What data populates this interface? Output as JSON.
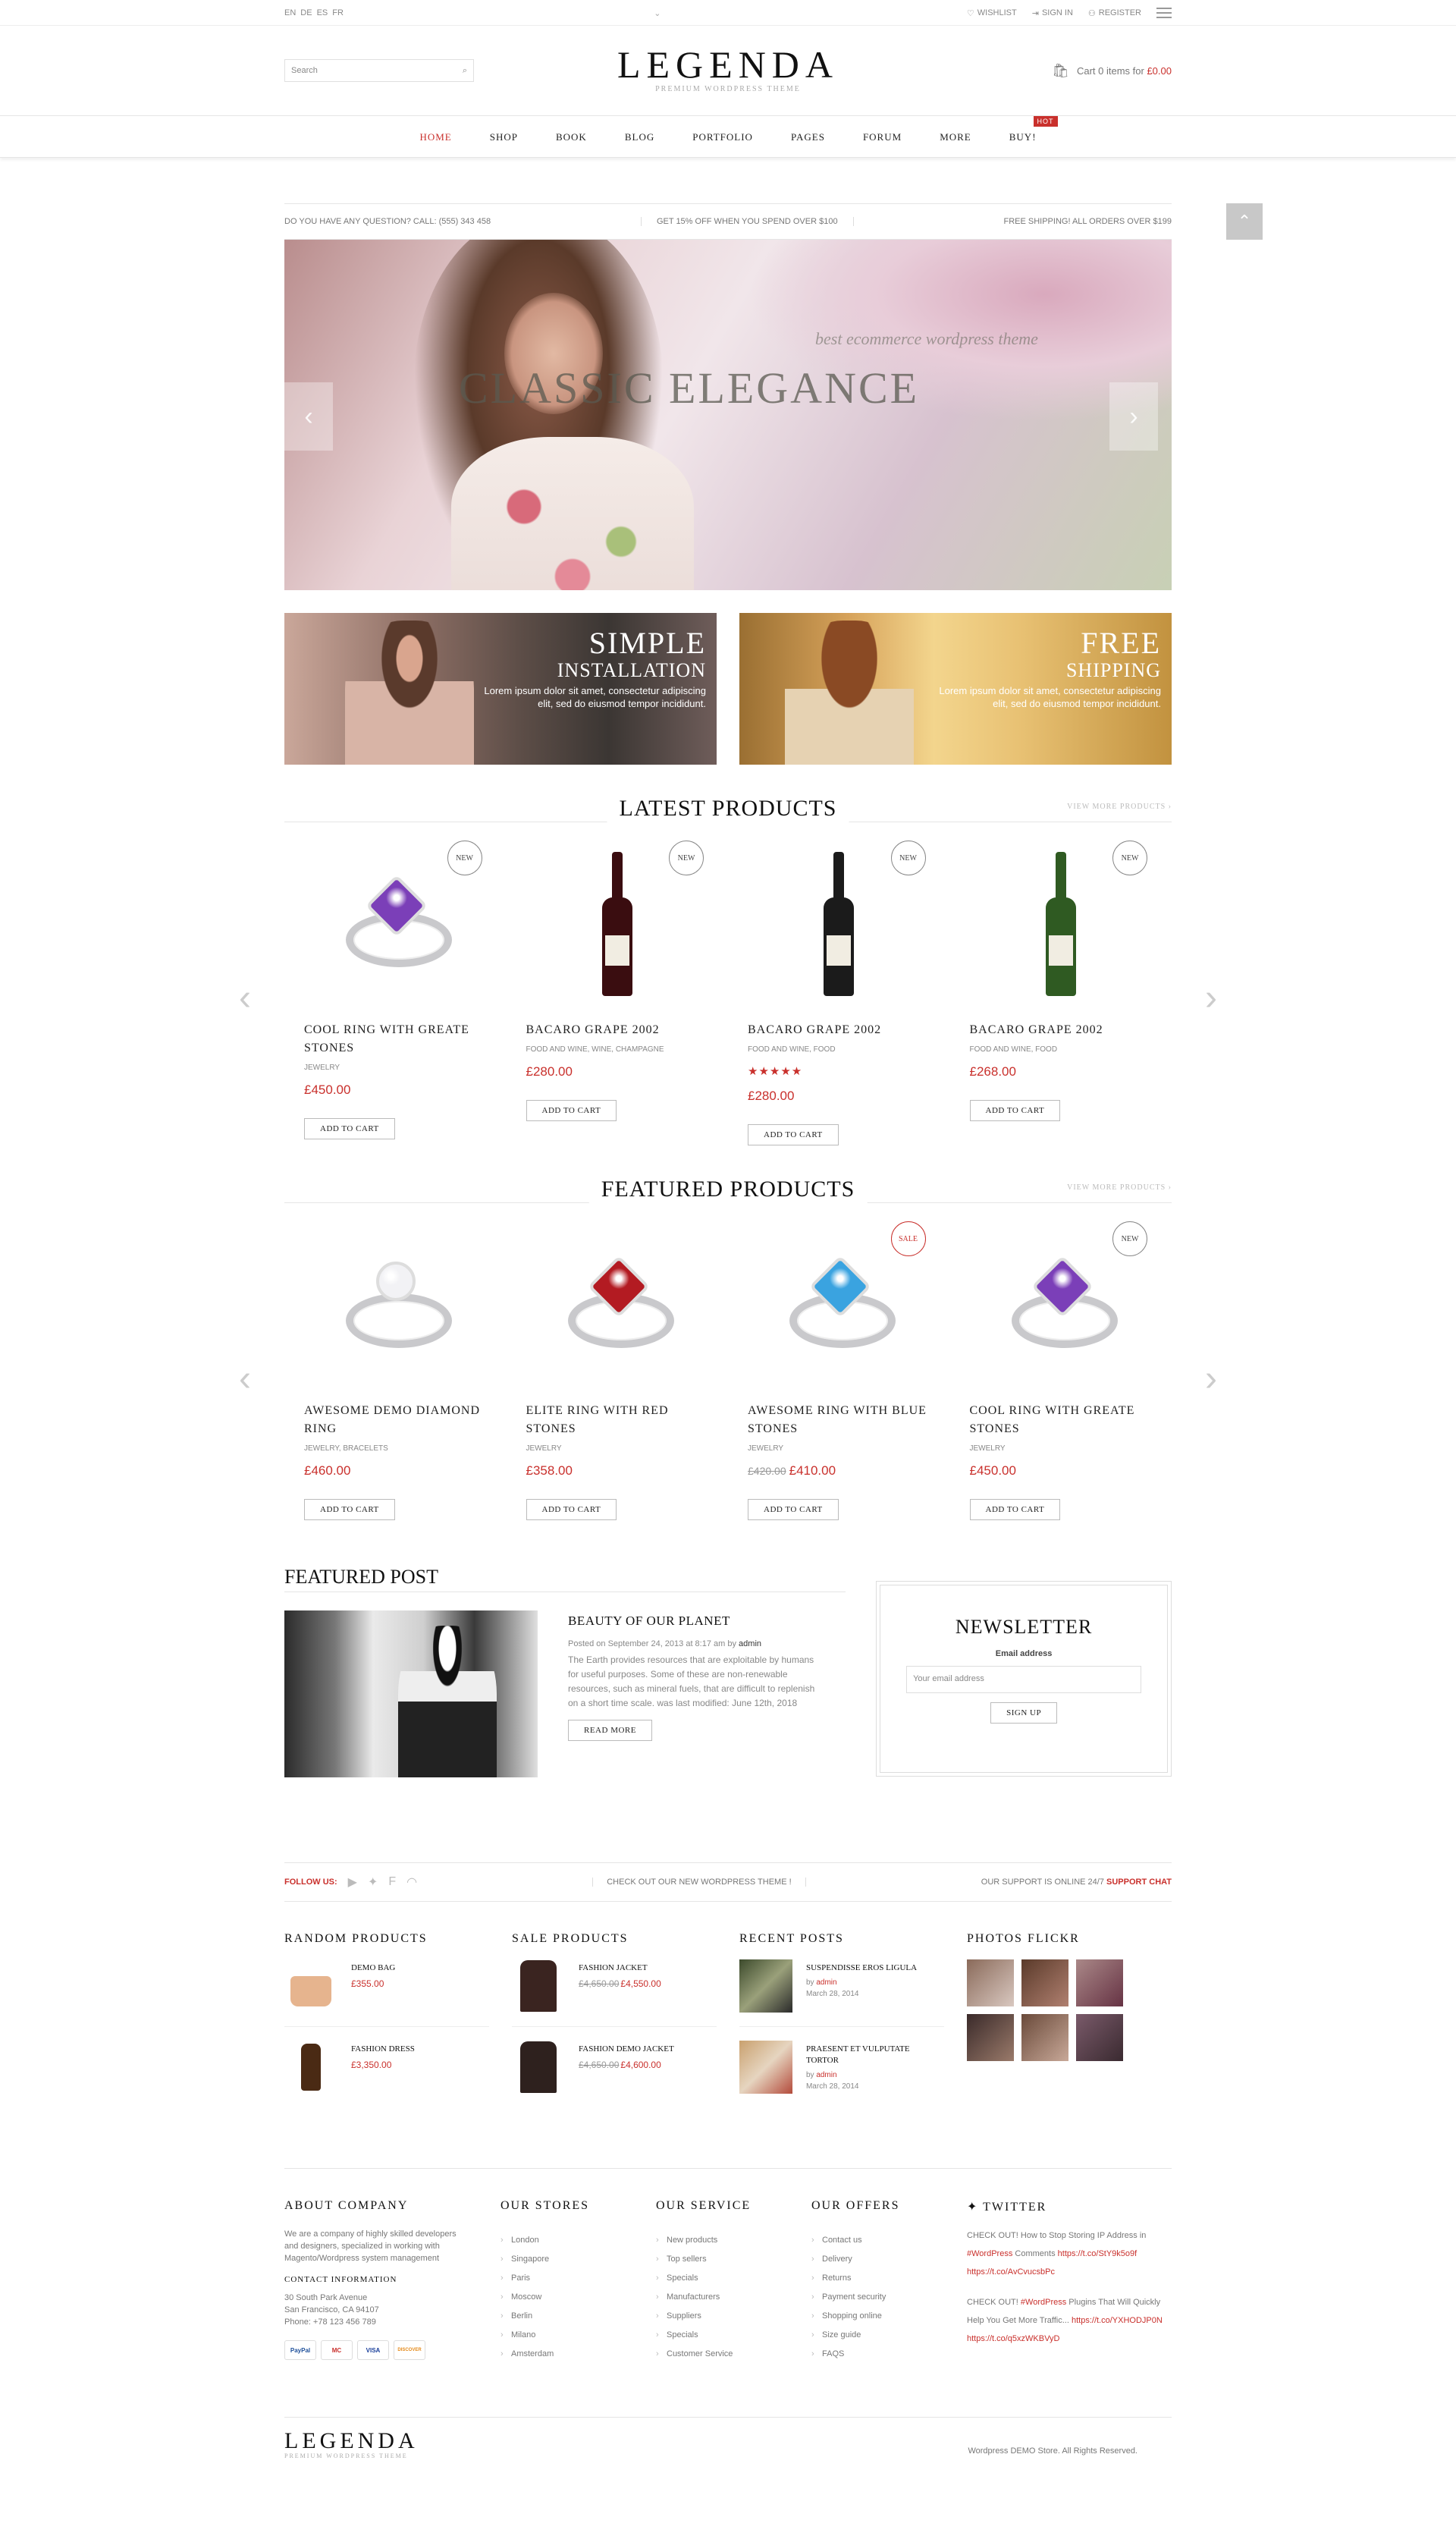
{
  "topbar": {
    "langs": [
      "EN",
      "DE",
      "ES",
      "FR"
    ],
    "wishlist": "Wishlist",
    "signin": "Sign In",
    "register": "Register"
  },
  "header": {
    "search_placeholder": "Search",
    "logo": "LEGENDA",
    "tagline": "PREMIUM WORDPRESS THEME",
    "cart_text": "Cart 0 items for",
    "cart_price": "£0.00"
  },
  "nav": {
    "items": [
      "HOME",
      "SHOP",
      "BOOK",
      "BLOG",
      "PORTFOLIO",
      "PAGES",
      "FORUM",
      "MORE",
      "BUY!"
    ],
    "hot": "HOT"
  },
  "infobar": {
    "left": "DO YOU HAVE ANY QUESTION? CALL: (555) 343 458",
    "middle": "GET 15% OFF WHEN YOU SPEND OVER $100",
    "right": "FREE SHIPPING! ALL ORDERS OVER $199"
  },
  "hero": {
    "title": "CLASSIC ELEGANCE",
    "subtitle": "best ecommerce wordpress theme"
  },
  "banners": [
    {
      "big": "SIMPLE",
      "small": "INSTALLATION",
      "text1": "Lorem ipsum dolor sit amet, consectetur adipiscing",
      "text2": "elit, sed do eiusmod tempor incididunt."
    },
    {
      "big": "FREE",
      "small": "SHIPPING",
      "text1": "Lorem ipsum dolor sit amet, consectetur adipiscing",
      "text2": "elit, sed do eiusmod tempor incididunt."
    }
  ],
  "latest": {
    "title": "LATEST PRODUCTS",
    "more": "VIEW MORE PRODUCTS ›",
    "items": [
      {
        "name": "COOL RING WITH GREATE STONES",
        "cat": "JEWELRY",
        "price": "£450.00",
        "badge": "NEW",
        "btn": "ADD TO CART",
        "type": "ring",
        "gem": "#7b3fb8"
      },
      {
        "name": "BACARO GRAPE 2002",
        "cat": "FOOD AND WINE, WINE, CHAMPAGNE",
        "price": "£280.00",
        "badge": "NEW",
        "btn": "ADD TO CART",
        "type": "bottle",
        "color": "#3a0d10"
      },
      {
        "name": "BACARO GRAPE 2002",
        "cat": "FOOD AND WINE, FOOD",
        "price": "£280.00",
        "badge": "NEW",
        "btn": "ADD TO CART",
        "type": "bottle",
        "color": "#1b1b1b",
        "stars": "★★★★★"
      },
      {
        "name": "BACARO GRAPE 2002",
        "cat": "FOOD AND WINE, FOOD",
        "price": "£268.00",
        "badge": "NEW",
        "btn": "ADD TO CART",
        "type": "bottle",
        "color": "#2f5a22"
      }
    ]
  },
  "featured": {
    "title": "FEATURED PRODUCTS",
    "more": "VIEW MORE PRODUCTS ›",
    "items": [
      {
        "name": "AWESOME DEMO DIAMOND RING",
        "cat": "JEWELRY, BRACELETS",
        "price": "£460.00",
        "badge": "",
        "btn": "ADD TO CART",
        "gem": "#f2f2f5",
        "round": true
      },
      {
        "name": "ELITE RING WITH RED STONES",
        "cat": "JEWELRY",
        "price": "£358.00",
        "badge": "",
        "btn": "ADD TO CART",
        "gem": "#b31b22"
      },
      {
        "name": "AWESOME RING WITH BLUE STONES",
        "cat": "JEWELRY",
        "old": "£420.00",
        "price": "£410.00",
        "badge": "SALE",
        "btn": "ADD TO CART",
        "gem": "#3aa3e0"
      },
      {
        "name": "COOL RING WITH GREATE STONES",
        "cat": "JEWELRY",
        "price": "£450.00",
        "badge": "NEW",
        "btn": "ADD TO CART",
        "gem": "#7b3fb8"
      }
    ]
  },
  "post": {
    "section": "FEATURED POST",
    "title": "BEAUTY OF OUR PLANET",
    "meta_pre": "Posted on September 24, 2013 at 8:17 am by",
    "author": "admin",
    "excerpt": "The Earth provides resources that are exploitable by humans for useful purposes. Some of these are non-renewable resources, such as mineral fuels, that are difficult to replenish on a short time scale. was last modified: June 12th, 2018",
    "btn": "READ MORE"
  },
  "newsletter": {
    "title": "NEWSLETTER",
    "label": "Email address",
    "placeholder": "Your email address",
    "btn": "SIGN UP"
  },
  "follow": {
    "label": "FOLLOW US:",
    "middle": "CHECK OUT OUR NEW WORDPRESS THEME !",
    "right": "OUR SUPPORT IS ONLINE 24/7",
    "chat": "SUPPORT CHAT"
  },
  "widgets": {
    "random": {
      "title": "RANDOM PRODUCTS",
      "items": [
        {
          "name": "DEMO BAG",
          "price": "£355.00"
        },
        {
          "name": "FASHION DRESS",
          "price": "£3,350.00"
        }
      ]
    },
    "sale": {
      "title": "SALE PRODUCTS",
      "items": [
        {
          "name": "FASHION JACKET",
          "old": "£4,650.00",
          "price": "£4,550.00"
        },
        {
          "name": "FASHION DEMO JACKET",
          "old": "£4,650.00",
          "price": "£4,600.00"
        }
      ]
    },
    "recent": {
      "title": "RECENT POSTS",
      "items": [
        {
          "name": "SUSPENDISSE EROS LIGULA",
          "by": "by",
          "author": "admin",
          "date": "March 28, 2014"
        },
        {
          "name": "PRAESENT ET VULPUTATE TORTOR",
          "by": "by",
          "author": "admin",
          "date": "March 28, 2014"
        }
      ]
    },
    "flickr": {
      "title": "PHOTOS FLICKR"
    }
  },
  "footer": {
    "about": {
      "title": "ABOUT COMPANY",
      "text": "We are a company of highly skilled developers and designers, specialized in working with Magento/Wordpress system management",
      "ci": "CONTACT INFORMATION",
      "addr1": "30 South Park Avenue",
      "addr2": "San Francisco, CA 94107",
      "phone": "Phone: +78 123 456 789",
      "cards": [
        "PayPal",
        "MC",
        "VISA",
        "DISCOVER"
      ]
    },
    "stores": {
      "title": "OUR STORES",
      "items": [
        "London",
        "Singapore",
        "Paris",
        "Moscow",
        "Berlin",
        "Milano",
        "Amsterdam"
      ]
    },
    "service": {
      "title": "OUR SERVICE",
      "items": [
        "New products",
        "Top sellers",
        "Specials",
        "Manufacturers",
        "Suppliers",
        "Specials",
        "Customer Service"
      ]
    },
    "offers": {
      "title": "OUR OFFERS",
      "items": [
        "Contact us",
        "Delivery",
        "Returns",
        "Payment security",
        "Shopping online",
        "Size guide",
        "FAQS"
      ]
    },
    "twitter": {
      "title": "TWITTER",
      "t1": "CHECK OUT! How to Stop Storing IP Address in",
      "t1b": "#WordPress",
      "t1c": "Comments",
      "t1d": "https://t.co/StY9k5o9f",
      "t1e": "https://t.co/AvCvucsbPc",
      "t2": "CHECK OUT!",
      "t2b": "#WordPress",
      "t2c": "Plugins That Will Quickly Help You Get More Traffic...",
      "t2d": "https://t.co/YXHODJP0N",
      "t2e": "https://t.co/q5xzWKBVyD"
    }
  },
  "bottom": {
    "logo": "LEGENDA",
    "tagline": "PREMIUM WORDPRESS THEME",
    "copy": "Wordpress DEMO Store. All Rights Reserved."
  }
}
